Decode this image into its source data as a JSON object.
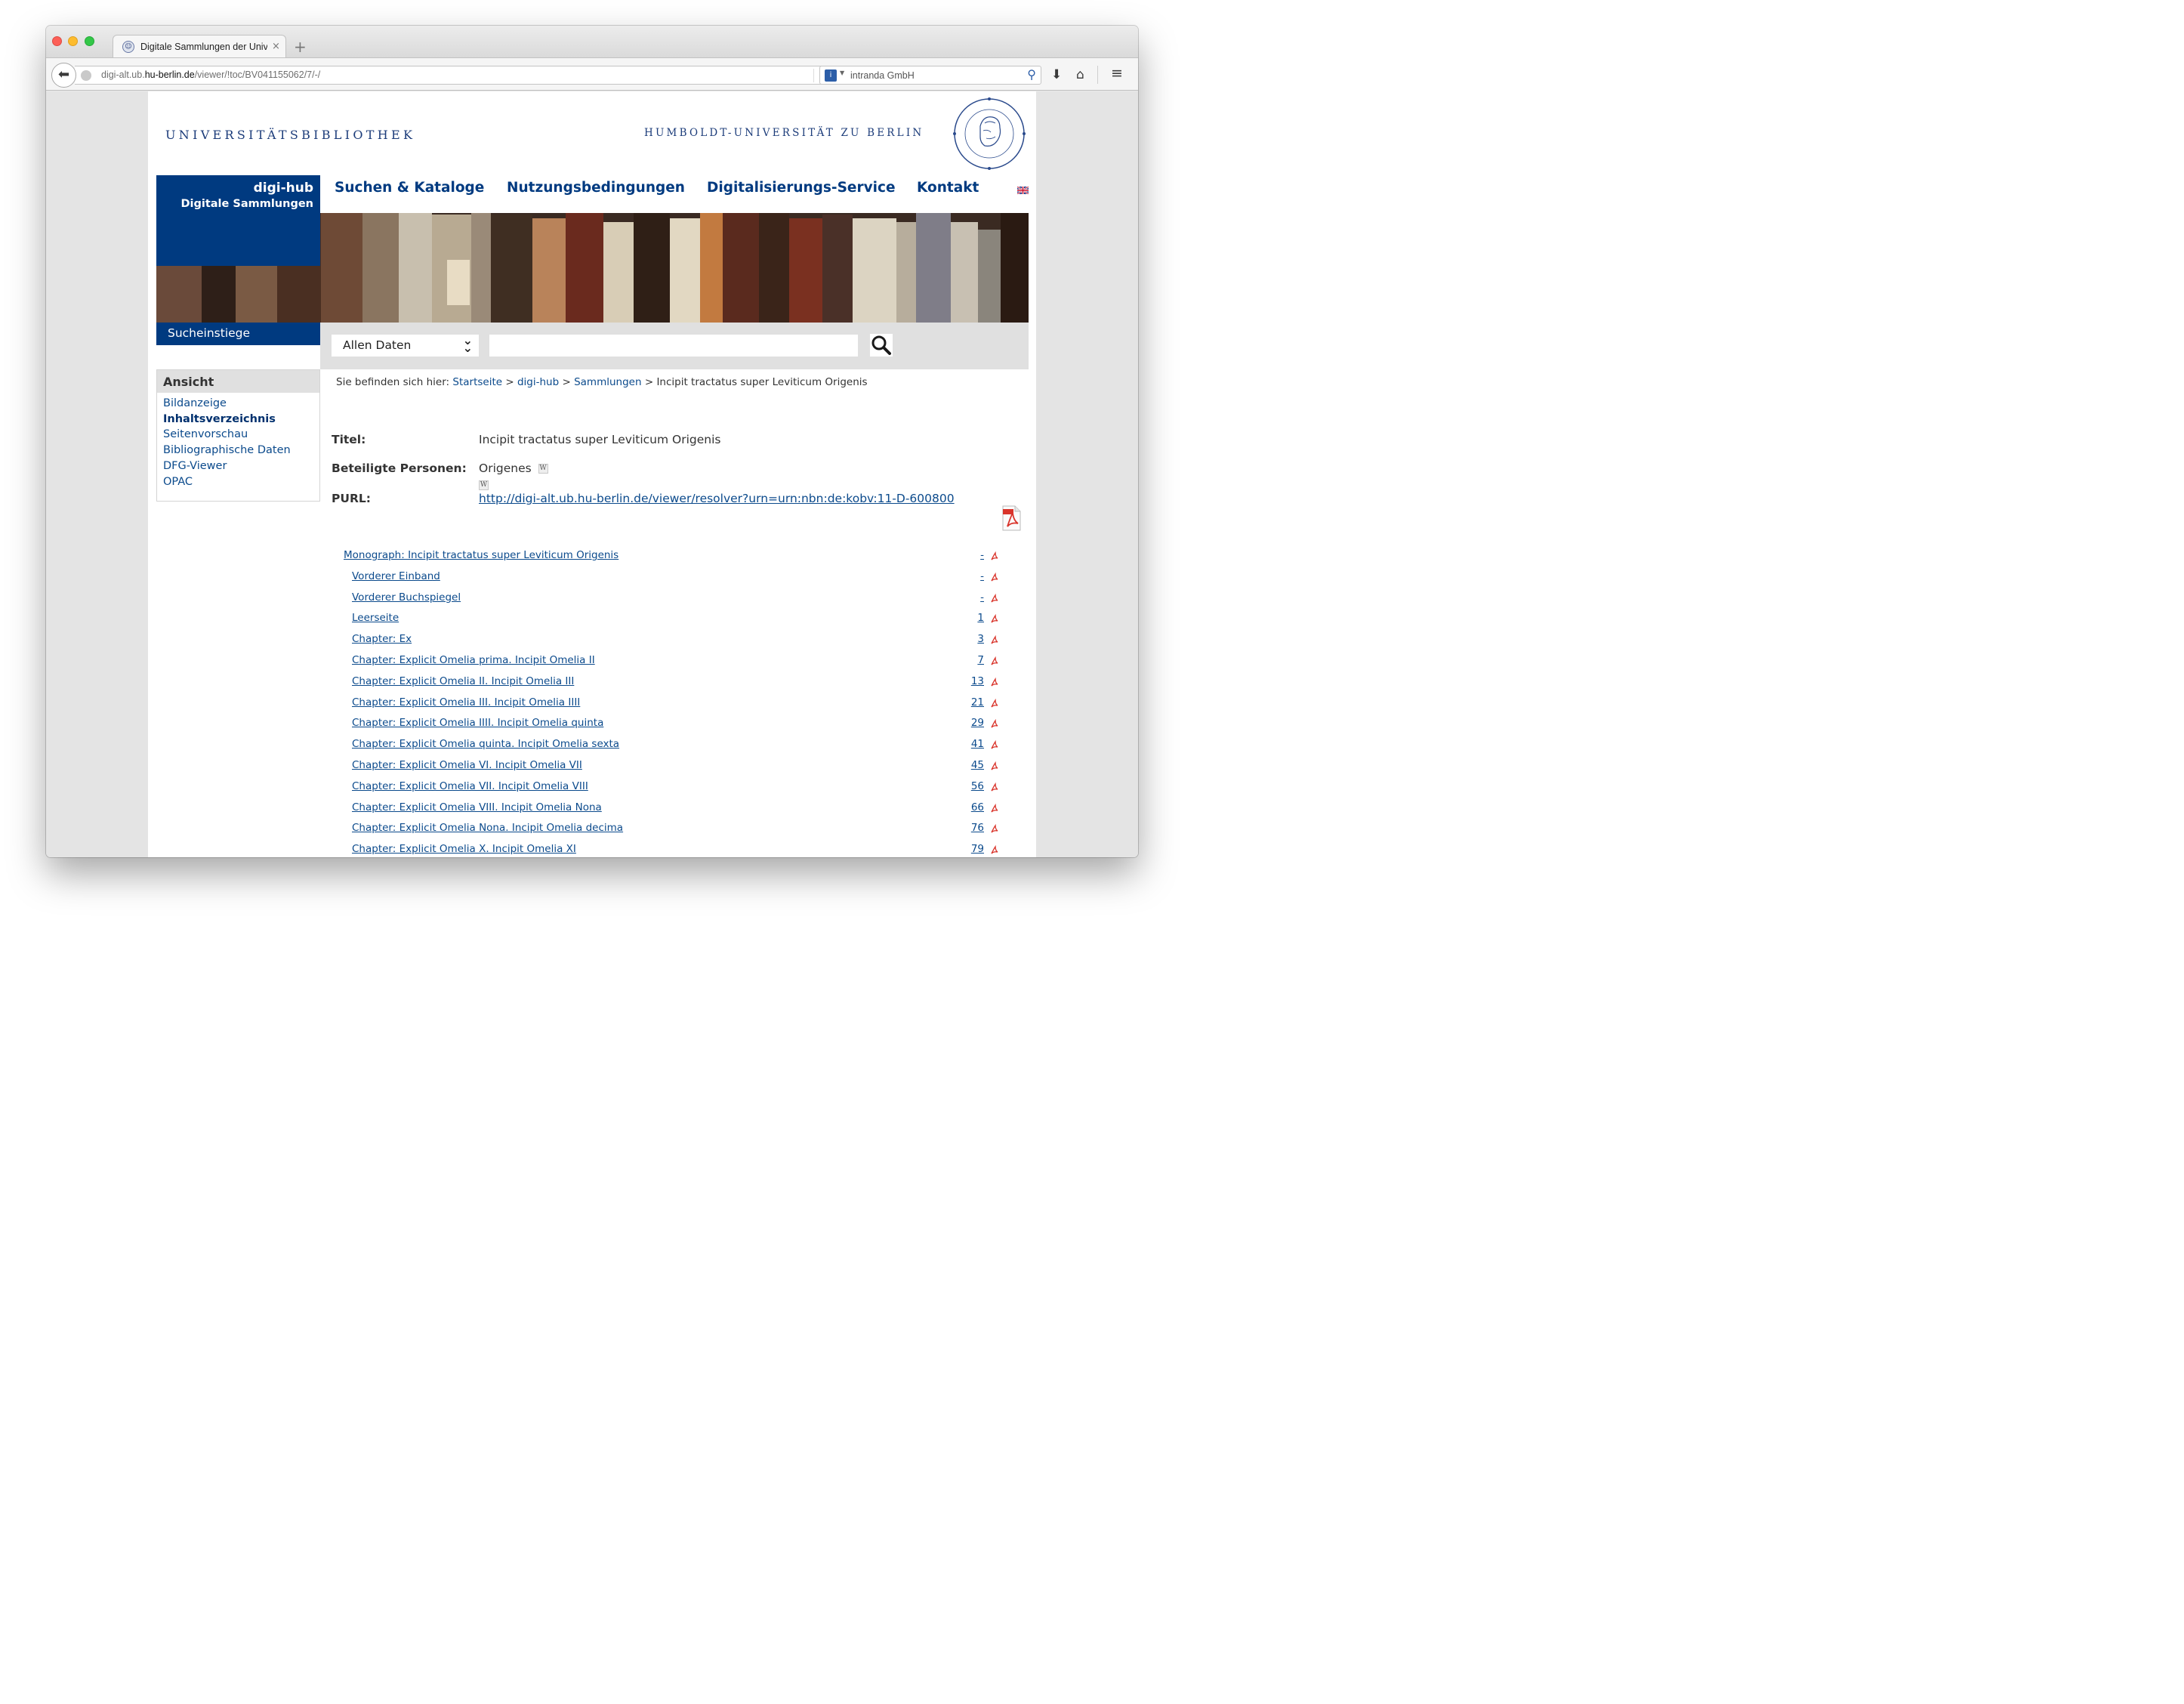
{
  "browser": {
    "tab_title": "Digitale Sammlungen der Univ...",
    "tab_close": "×",
    "new_tab": "+",
    "url_prefix": "digi-alt.ub.",
    "url_domain": "hu-berlin.de",
    "url_path": "/viewer/!toc/BV041155062/7/-/",
    "search_engine": "intranda GmbH"
  },
  "site": {
    "library_title": "UNIVERSITÄTSBIBLIOTHEK",
    "university_title": "HUMBOLDT-UNIVERSITÄT ZU BERLIN",
    "brand_line1": "digi-hub",
    "brand_line2": "Digitale Sammlungen",
    "nav": [
      "Suchen & Kataloge",
      "Nutzungsbedingungen",
      "Digitalisierungs-Service",
      "Kontakt"
    ],
    "search_entry_label": "Sucheinstiege",
    "search_scope": "Allen Daten",
    "search_query": ""
  },
  "sidebar": {
    "heading": "Ansicht",
    "items": [
      "Bildanzeige",
      "Inhaltsverzeichnis",
      "Seitenvorschau",
      "Bibliographische Daten",
      "DFG-Viewer",
      "OPAC"
    ],
    "active": "Inhaltsverzeichnis"
  },
  "breadcrumb": {
    "prefix": "Sie befinden sich hier:",
    "links": [
      "Startseite",
      "digi-hub",
      "Sammlungen"
    ],
    "current": "Incipit tractatus super Leviticum Origenis",
    "separator": ">"
  },
  "record": {
    "title_label": "Titel:",
    "title_value": "Incipit tractatus super Leviticum Origenis",
    "persons_label": "Beteiligte Personen:",
    "persons_value": "Origenes",
    "purl_label": "PURL:",
    "purl_value": "http://digi-alt.ub.hu-berlin.de/viewer/resolver?urn=urn:nbn:de:kobv:11-D-600800",
    "wiki_badge": "W"
  },
  "toc": [
    {
      "title": "Monograph: Incipit tractatus super Leviticum Origenis",
      "page": "-",
      "level": 0
    },
    {
      "title": "Vorderer Einband",
      "page": "-",
      "level": 1
    },
    {
      "title": "Vorderer Buchspiegel",
      "page": "-",
      "level": 1
    },
    {
      "title": "Leerseite",
      "page": "1",
      "level": 1
    },
    {
      "title": "Chapter: Ex",
      "page": "3",
      "level": 1
    },
    {
      "title": "Chapter: Explicit Omelia prima. Incipit Omelia II",
      "page": "7",
      "level": 1
    },
    {
      "title": "Chapter: Explicit Omelia II. Incipit Omelia III",
      "page": "13",
      "level": 1
    },
    {
      "title": "Chapter: Explicit Omelia III. Incipit Omelia IIII",
      "page": "21",
      "level": 1
    },
    {
      "title": "Chapter: Explicit Omelia IIII. Incipit Omelia quinta",
      "page": "29",
      "level": 1
    },
    {
      "title": "Chapter: Explicit Omelia quinta. Incipit Omelia sexta",
      "page": "41",
      "level": 1
    },
    {
      "title": "Chapter: Explicit Omelia VI. Incipit Omelia VII",
      "page": "45",
      "level": 1
    },
    {
      "title": "Chapter: Explicit Omelia VII. Incipit Omelia VIII",
      "page": "56",
      "level": 1
    },
    {
      "title": "Chapter: Explicit Omelia VIII. Incipit Omelia Nona",
      "page": "66",
      "level": 1
    },
    {
      "title": "Chapter: Explicit Omelia Nona. Incipit Omelia decima",
      "page": "76",
      "level": 1
    },
    {
      "title": "Chapter: Explicit Omelia X. Incipit Omelia XI",
      "page": "79",
      "level": 1
    }
  ],
  "colors": {
    "brand_blue": "#003a80",
    "link_blue": "#0b4a8c",
    "pdf_red": "#d9342b"
  },
  "icons": {
    "back": "back-arrow-icon",
    "reload": "reload-icon",
    "download": "download-icon",
    "home": "home-icon",
    "menu": "menu-icon",
    "search": "search-icon",
    "pdf": "pdf-icon",
    "flag": "uk-flag-icon",
    "scroll_top": "scroll-top-icon"
  }
}
